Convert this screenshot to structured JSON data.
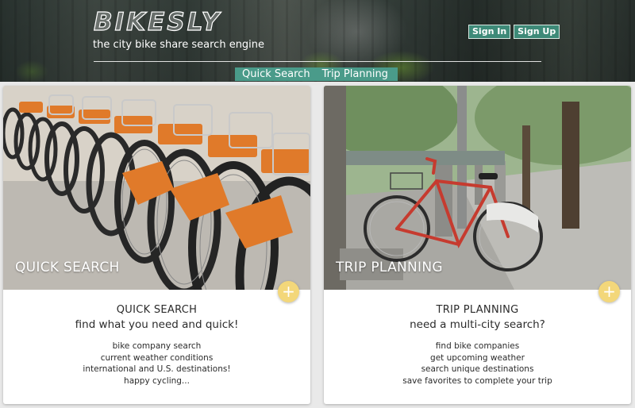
{
  "header": {
    "brand": "BIKESLY",
    "tagline": "the city bike share search engine",
    "auth": {
      "sign_in": "Sign In",
      "sign_up": "Sign Up"
    },
    "nav": [
      "Quick Search",
      "Trip Planning"
    ]
  },
  "cards": [
    {
      "image_title": "QUICK SEARCH",
      "heading": "QUICK SEARCH",
      "subheading": "find what you need and quick!",
      "items": [
        "bike company search",
        "current weather conditions",
        "international and U.S. destinations!",
        "happy cycling..."
      ],
      "fab": "+"
    },
    {
      "image_title": "TRIP PLANNING",
      "heading": "TRIP PLANNING",
      "subheading": "need a multi-city search?",
      "items": [
        "find bike companies",
        "get upcoming weather",
        "search unique destinations",
        "save favorites to complete your trip"
      ],
      "fab": "+"
    }
  ],
  "colors": {
    "accent": "#4a9b8a",
    "fab": "#f3d77a",
    "bike_orange": "#e07a2a",
    "bike_red": "#c63b2f"
  }
}
